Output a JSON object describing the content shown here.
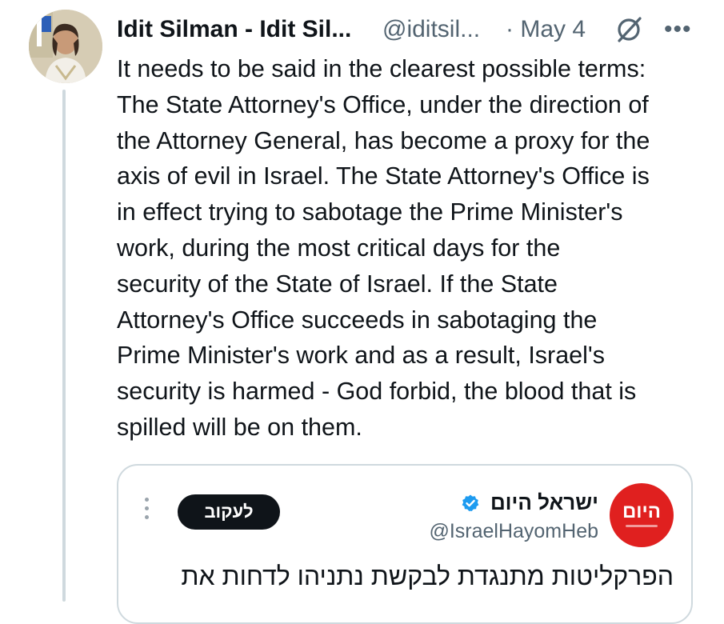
{
  "tweet": {
    "author_name": "Idit Silman - Idit Sil...",
    "author_handle": "@iditsil...",
    "date": "· May 4",
    "grok_icon": "grok-slash-circle-icon",
    "more_icon": "more-horizontal-icon",
    "text": "It needs to be said in the clearest possible terms:\nThe State Attorney's Office, under the direction of\nthe Attorney General, has become a proxy for the\naxis of evil in Israel. The State Attorney's Office is\nin effect trying to sabotage the Prime Minister's\nwork, during the most critical days for the\nsecurity of the State of Israel. If the State\nAttorney's Office succeeds in sabotaging the\nPrime Minister's work and as a result, Israel's\nsecurity is harmed - God forbid, the blood that is\nspilled will be on them."
  },
  "quote": {
    "logo_text": "היום",
    "name": "ישראל היום",
    "verified_icon": "verified-badge-icon",
    "handle": "@IsraelHayomHeb",
    "follow_label": "לעקוב",
    "more_icon": "more-vertical-icon",
    "text": "הפרקליטות מתנגדת לבקשת נתניהו לדחות את"
  },
  "colors": {
    "text_primary": "#0f1419",
    "text_secondary": "#536471",
    "border": "#cfd9de",
    "verified_blue": "#1d9bf0",
    "logo_red": "#e0201f",
    "follow_bg": "#0f1419"
  }
}
